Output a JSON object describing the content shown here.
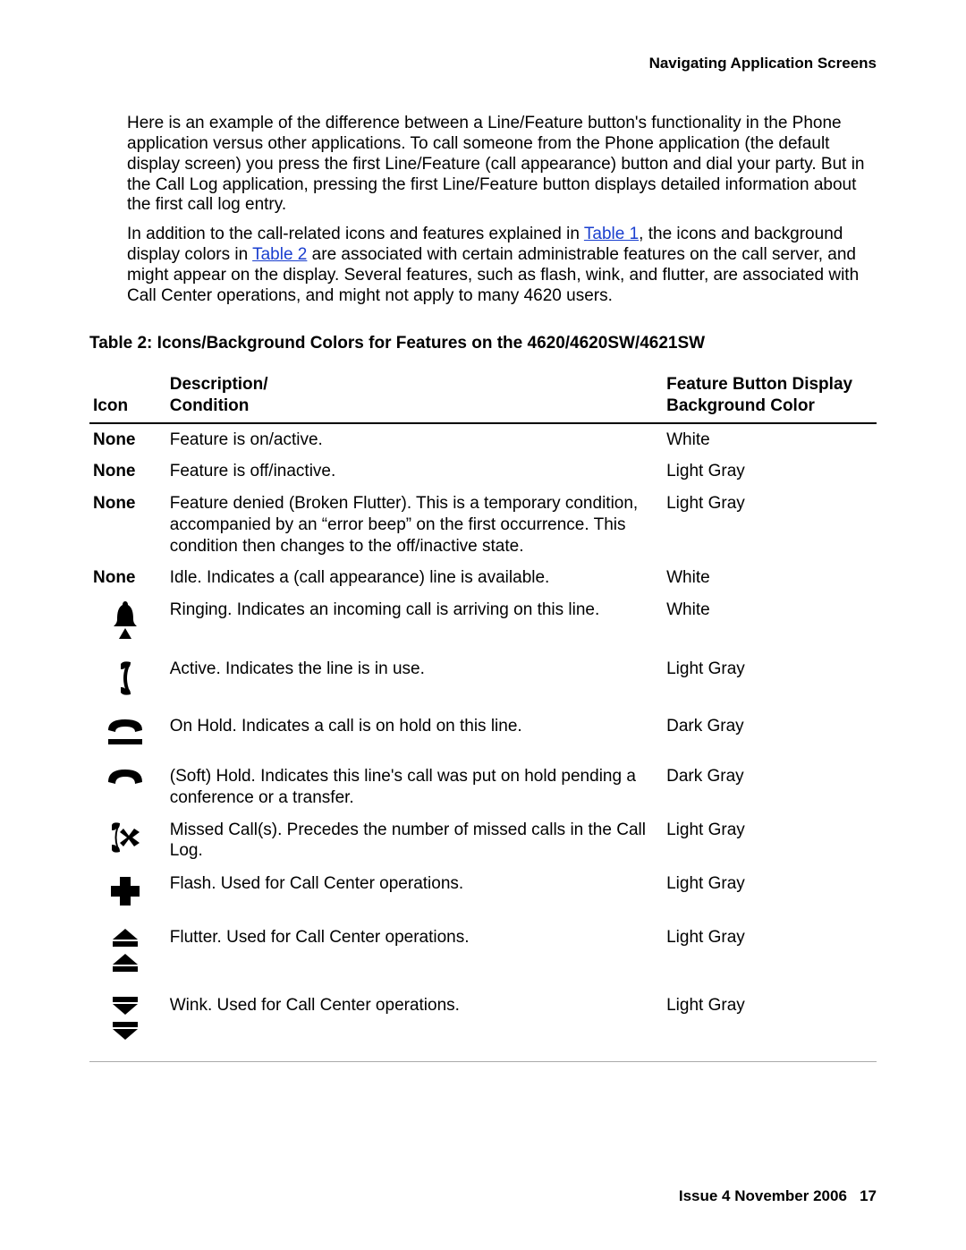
{
  "header": {
    "title": "Navigating Application Screens"
  },
  "body": {
    "p1": "Here is an example of the difference between a Line/Feature button's functionality in the Phone application versus other applications. To call someone from the Phone application (the default display screen) you press the first Line/Feature (call appearance) button and dial your party. But in the Call Log application, pressing the first Line/Feature button displays detailed information about the first call log entry.",
    "p2_pre": "In addition to the call-related icons and features explained in ",
    "p2_link1": "Table 1",
    "p2_mid": ", the icons and background display colors in ",
    "p2_link2": "Table 2",
    "p2_post": " are associated with certain administrable features on the call server, and might appear on the display. Several features, such as flash, wink, and flutter, are associated with Call Center operations, and might not apply to many 4620 users."
  },
  "table": {
    "caption_prefix": "Table 2:",
    "caption_rest": "  Icons/Background Colors for Features on the 4620/4620SW/4621SW",
    "header": {
      "icon": "Icon",
      "desc_line1": "Description/",
      "desc_line2": "Condition",
      "color_line1": "Feature Button Display",
      "color_line2": "Background Color"
    },
    "rows": [
      {
        "icon_text": "None",
        "icon_svg": "",
        "desc": "Feature is on/active.",
        "color": "White"
      },
      {
        "icon_text": "None",
        "icon_svg": "",
        "desc": "Feature is off/inactive.",
        "color": "Light Gray"
      },
      {
        "icon_text": "None",
        "icon_svg": "",
        "desc": "Feature denied (Broken Flutter). This is a temporary condition, accompanied by an “error beep” on the first occurrence. This condition then changes to the off/inactive state.",
        "color": "Light Gray"
      },
      {
        "icon_text": "None",
        "icon_svg": "",
        "desc": "Idle. Indicates a (call appearance) line is available.",
        "color": "White"
      },
      {
        "icon_text": "",
        "icon_svg": "ringing",
        "desc": "Ringing. Indicates an incoming call is arriving on this line.",
        "color": "White"
      },
      {
        "icon_text": "",
        "icon_svg": "active",
        "desc": "Active. Indicates the line is in use.",
        "color": "Light Gray"
      },
      {
        "icon_text": "",
        "icon_svg": "hold",
        "desc": "On Hold. Indicates a call is on hold on this line.",
        "color": "Dark Gray"
      },
      {
        "icon_text": "",
        "icon_svg": "softhold",
        "desc": "(Soft) Hold. Indicates this line's call was put on hold pending a conference or a transfer.",
        "color": "Dark Gray"
      },
      {
        "icon_text": "",
        "icon_svg": "missed",
        "desc": "Missed Call(s). Precedes the number of missed calls in the Call Log.",
        "color": "Light Gray"
      },
      {
        "icon_text": "",
        "icon_svg": "flash",
        "desc": "Flash. Used for Call Center operations.",
        "color": "Light Gray"
      },
      {
        "icon_text": "",
        "icon_svg": "flutter",
        "desc": "Flutter. Used for Call Center operations.",
        "color": "Light Gray"
      },
      {
        "icon_text": "",
        "icon_svg": "wink",
        "desc": "Wink. Used for Call Center operations.",
        "color": "Light Gray"
      }
    ]
  },
  "footer": {
    "issue": "Issue 4   November 2006",
    "page": "17"
  }
}
